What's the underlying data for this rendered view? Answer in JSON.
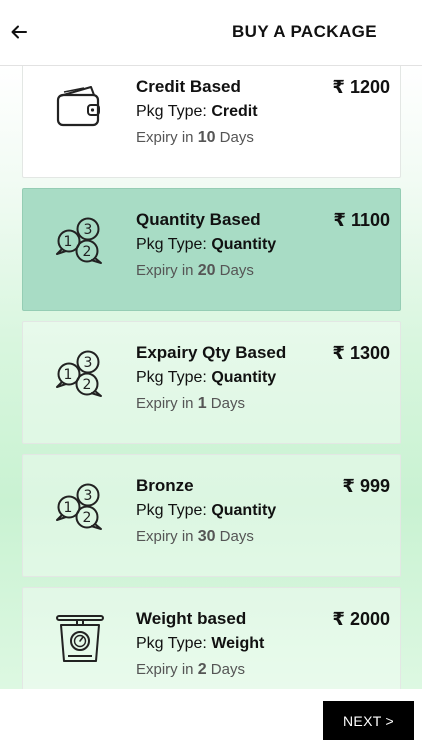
{
  "header": {
    "title": "BUY A PACKAGE",
    "back_icon": "arrow-left-icon"
  },
  "labels": {
    "pkg_type": "Pkg Type:",
    "expiry_prefix": "Expiry in",
    "expiry_suffix": "Days",
    "currency": "₹"
  },
  "packages": [
    {
      "name": "Credit Based",
      "type": "Credit",
      "days": "10",
      "price": "1200",
      "icon": "wallet-icon",
      "selected": false
    },
    {
      "name": "Quantity Based",
      "type": "Quantity",
      "days": "20",
      "price": "1100",
      "icon": "numbers-chat-icon",
      "selected": true
    },
    {
      "name": "Expairy Qty Based",
      "type": "Quantity",
      "days": "1",
      "price": "1300",
      "icon": "numbers-chat-icon",
      "selected": false
    },
    {
      "name": "Bronze",
      "type": "Quantity",
      "days": "30",
      "price": "999",
      "icon": "numbers-chat-icon",
      "selected": false
    },
    {
      "name": "Weight based",
      "type": "Weight",
      "days": "2",
      "price": "2000",
      "icon": "weighing-scale-icon",
      "selected": false
    }
  ],
  "footer": {
    "next_label": "NEXT >"
  },
  "colors": {
    "selected_card": "#a8dcc5",
    "button": "#000000"
  }
}
